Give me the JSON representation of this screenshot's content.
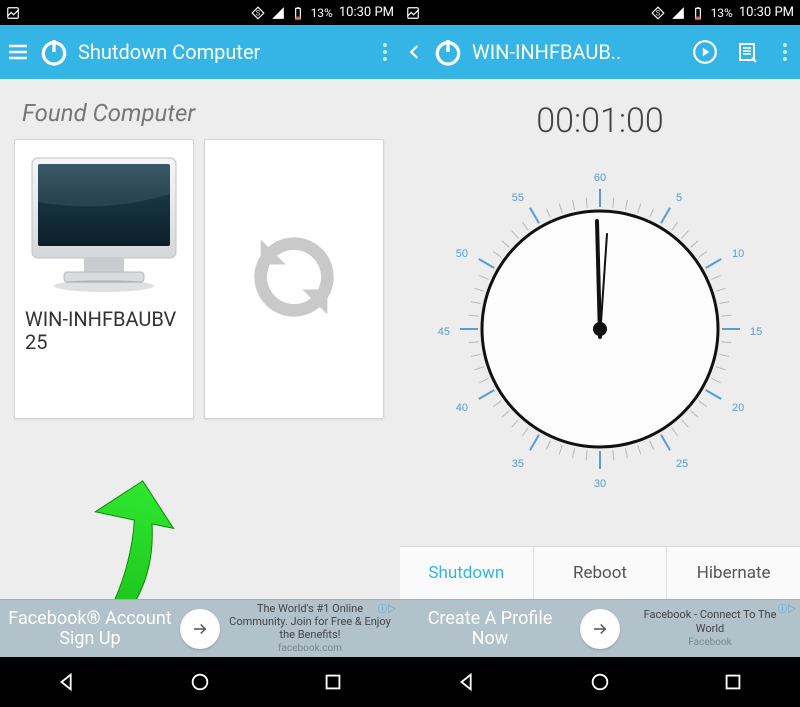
{
  "status": {
    "battery": "13%",
    "time": "10:30 PM"
  },
  "left": {
    "appbar_title": "Shutdown Computer",
    "section_title": "Found Computer",
    "computer_name": "WIN-INHFBAUBV25",
    "ad": {
      "left_text": "Facebook® Account Sign Up",
      "right_title": "The World's #1 Online Community. Join for Free & Enjoy the Benefits!",
      "right_sub": "facebook.com"
    }
  },
  "right": {
    "appbar_title": "WIN-INHFBAUB..",
    "timer": "00:01:00",
    "actions": {
      "shutdown": "Shutdown",
      "reboot": "Reboot",
      "hibernate": "Hibernate"
    },
    "dial_labels": {
      "t60": "60",
      "t55": "55",
      "t50": "50",
      "t45": "45",
      "t40": "40",
      "t35": "35",
      "t30": "30",
      "t25": "25",
      "t20": "20",
      "t15": "15",
      "t10": "10",
      "t5": "5"
    },
    "ad": {
      "left_text": "Create A Profile Now",
      "right_title": "Facebook - Connect To The World",
      "right_sub": "Facebook"
    }
  }
}
